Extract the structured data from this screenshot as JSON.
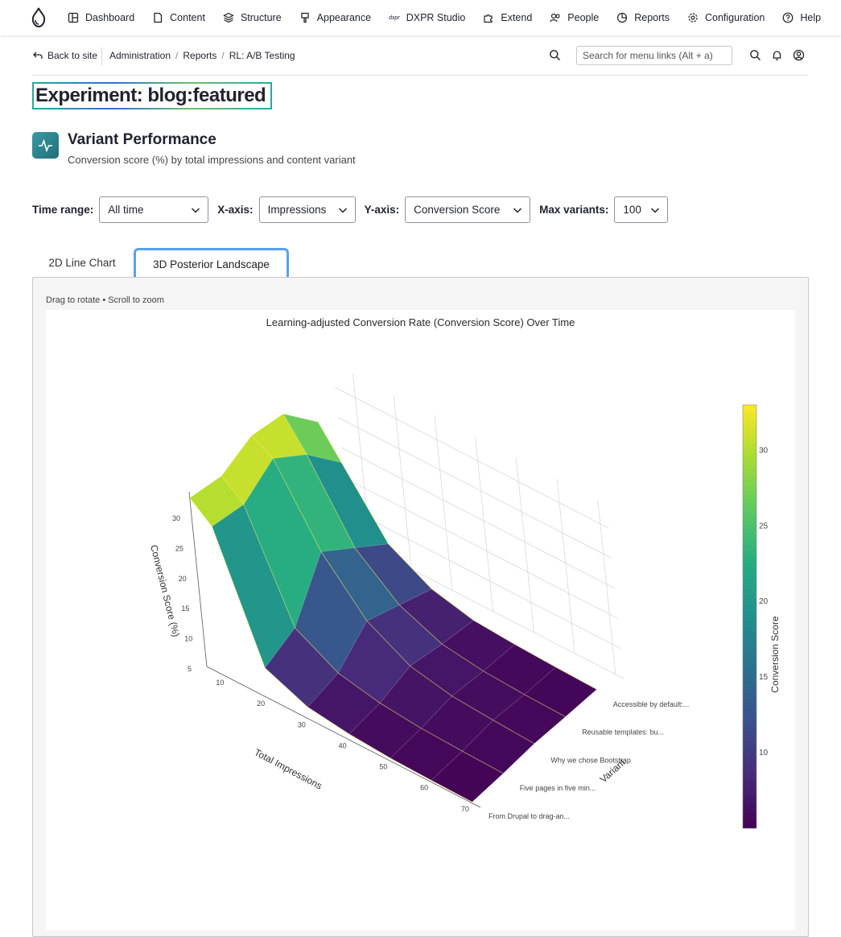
{
  "nav": {
    "items": [
      {
        "label": "Dashboard",
        "icon": "dashboard-icon"
      },
      {
        "label": "Content",
        "icon": "content-icon"
      },
      {
        "label": "Structure",
        "icon": "structure-icon"
      },
      {
        "label": "Appearance",
        "icon": "appearance-icon"
      },
      {
        "label": "DXPR Studio",
        "icon": "dxpr-icon"
      },
      {
        "label": "Extend",
        "icon": "extend-icon"
      },
      {
        "label": "People",
        "icon": "people-icon"
      },
      {
        "label": "Reports",
        "icon": "reports-icon"
      },
      {
        "label": "Configuration",
        "icon": "gear-icon"
      },
      {
        "label": "Help",
        "icon": "help-icon"
      }
    ],
    "dxpr_mark": "dxpr"
  },
  "subbar": {
    "back_label": "Back to site",
    "breadcrumbs": [
      "Administration",
      "Reports",
      "RL: A/B Testing"
    ],
    "search_placeholder": "Search for menu links (Alt + a)"
  },
  "page": {
    "title": "Experiment: blog:featured",
    "section_title": "Variant Performance",
    "section_subtitle": "Conversion score (%) by total impressions and content variant"
  },
  "filters": {
    "time_range": {
      "label": "Time range:",
      "value": "All time"
    },
    "x_axis": {
      "label": "X-axis:",
      "value": "Impressions"
    },
    "y_axis": {
      "label": "Y-axis:",
      "value": "Conversion Score"
    },
    "max_variants": {
      "label": "Max variants:",
      "value": "100"
    }
  },
  "tabs": [
    {
      "label": "2D Line Chart",
      "active": false
    },
    {
      "label": "3D Posterior Landscape",
      "active": true
    }
  ],
  "chart": {
    "hint": "Drag to rotate • Scroll to zoom",
    "title": "Learning-adjusted Conversion Rate (Conversion Score) Over Time"
  },
  "chart_data": {
    "type": "surface",
    "title": "Learning-adjusted Conversion Rate (Conversion Score) Over Time",
    "xlabel": "Total Impressions",
    "ylabel": "Variant",
    "zlabel": "Conversion Score (%)",
    "x_ticks": [
      10,
      20,
      30,
      40,
      50,
      60,
      70
    ],
    "z_ticks": [
      5,
      10,
      15,
      20,
      25,
      30
    ],
    "variants": [
      "From Drupal to drag-an...",
      "Five pages in five min...",
      "Why we chose Bootstrap",
      "Reusable templates: bu...",
      "Accessible by default:..."
    ],
    "colorbar": {
      "title": "Conversion Score",
      "ticks": [
        10,
        15,
        20,
        25,
        30
      ],
      "colorscale": "viridis"
    },
    "x": [
      5,
      10,
      20,
      30,
      40,
      50,
      60,
      70
    ],
    "z": [
      [
        33,
        30,
        10,
        7,
        6,
        5.5,
        5.3,
        5.2
      ],
      [
        32,
        29,
        12,
        8,
        6.5,
        5.8,
        5.5,
        5.3
      ],
      [
        34,
        32,
        20,
        12,
        8,
        6.5,
        6,
        5.6
      ],
      [
        33,
        28,
        16,
        10,
        7,
        6,
        5.6,
        5.4
      ],
      [
        27,
        22,
        12,
        8,
        6.3,
        5.8,
        5.5,
        5.3
      ]
    ]
  }
}
